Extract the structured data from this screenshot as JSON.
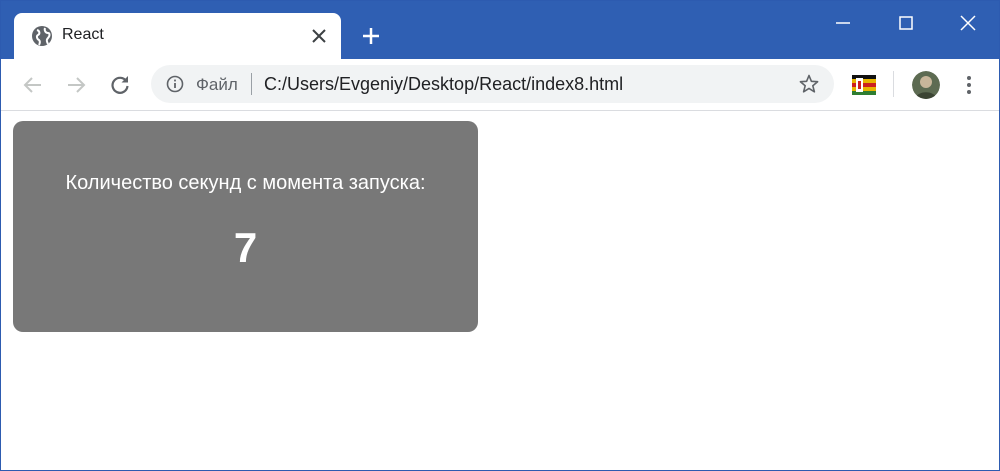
{
  "browser": {
    "tab": {
      "title": "React",
      "favicon": "globe-icon"
    },
    "address_bar": {
      "security_label": "Файл",
      "url": "C:/Users/Evgeniy/Desktop/React/index8.html"
    },
    "colors": {
      "titlebar": "#2f5fb3",
      "omnibox": "#f1f3f4"
    }
  },
  "page": {
    "timer": {
      "label": "Количество секунд с момента запуска:",
      "value": "7",
      "background": "#787878"
    }
  }
}
